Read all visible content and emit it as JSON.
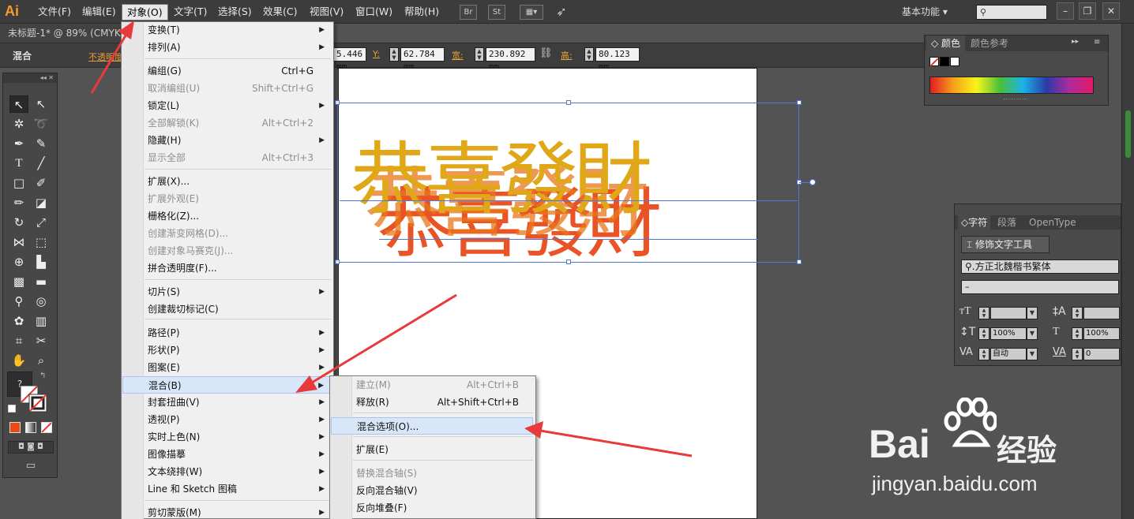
{
  "app": {
    "logo": "Ai"
  },
  "menubar": {
    "items": [
      "文件(F)",
      "编辑(E)",
      "对象(O)",
      "文字(T)",
      "选择(S)",
      "效果(C)",
      "视图(V)",
      "窗口(W)",
      "帮助(H)"
    ],
    "active": "对象(O)",
    "toolbar_icons": [
      "Br",
      "St"
    ],
    "workspace": "基本功能",
    "search_placeholder": "",
    "window_controls": [
      "–",
      "❐",
      "✕"
    ]
  },
  "document": {
    "tab": "未标题-1* @ 89% (CMYK"
  },
  "control_bar": {
    "blend_label": "混合",
    "opacity_label": "不透明度",
    "x_value": "5.446 mm",
    "y_label": "Y:",
    "y_value": "62.784 mm",
    "w_label": "宽:",
    "w_value": "230.892 mm",
    "h_label": "高:",
    "h_value": "80.123 mm"
  },
  "object_menu": {
    "items": [
      {
        "label": "变换(T)",
        "shortcut": "",
        "submenu": true,
        "disabled": false
      },
      {
        "label": "排列(A)",
        "shortcut": "",
        "submenu": true,
        "disabled": false
      },
      {
        "label": "编组(G)",
        "shortcut": "Ctrl+G",
        "submenu": false,
        "disabled": false
      },
      {
        "label": "取消编组(U)",
        "shortcut": "Shift+Ctrl+G",
        "submenu": false,
        "disabled": true
      },
      {
        "label": "锁定(L)",
        "shortcut": "",
        "submenu": true,
        "disabled": false
      },
      {
        "label": "全部解锁(K)",
        "shortcut": "Alt+Ctrl+2",
        "submenu": false,
        "disabled": true
      },
      {
        "label": "隐藏(H)",
        "shortcut": "",
        "submenu": true,
        "disabled": false
      },
      {
        "label": "显示全部",
        "shortcut": "Alt+Ctrl+3",
        "submenu": false,
        "disabled": true
      },
      {
        "label": "扩展(X)...",
        "shortcut": "",
        "submenu": false,
        "disabled": false
      },
      {
        "label": "扩展外观(E)",
        "shortcut": "",
        "submenu": false,
        "disabled": true
      },
      {
        "label": "栅格化(Z)...",
        "shortcut": "",
        "submenu": false,
        "disabled": false
      },
      {
        "label": "创建渐变网格(D)...",
        "shortcut": "",
        "submenu": false,
        "disabled": true
      },
      {
        "label": "创建对象马赛克(J)...",
        "shortcut": "",
        "submenu": false,
        "disabled": true
      },
      {
        "label": "拼合透明度(F)...",
        "shortcut": "",
        "submenu": false,
        "disabled": false
      },
      {
        "label": "切片(S)",
        "shortcut": "",
        "submenu": true,
        "disabled": false
      },
      {
        "label": "创建裁切标记(C)",
        "shortcut": "",
        "submenu": false,
        "disabled": false
      },
      {
        "label": "路径(P)",
        "shortcut": "",
        "submenu": true,
        "disabled": false
      },
      {
        "label": "形状(P)",
        "shortcut": "",
        "submenu": true,
        "disabled": false
      },
      {
        "label": "图案(E)",
        "shortcut": "",
        "submenu": true,
        "disabled": false
      },
      {
        "label": "混合(B)",
        "shortcut": "",
        "submenu": true,
        "disabled": false
      },
      {
        "label": "封套扭曲(V)",
        "shortcut": "",
        "submenu": true,
        "disabled": false
      },
      {
        "label": "透视(P)",
        "shortcut": "",
        "submenu": true,
        "disabled": false
      },
      {
        "label": "实时上色(N)",
        "shortcut": "",
        "submenu": true,
        "disabled": false
      },
      {
        "label": "图像描摹",
        "shortcut": "",
        "submenu": true,
        "disabled": false
      },
      {
        "label": "文本绕排(W)",
        "shortcut": "",
        "submenu": true,
        "disabled": false
      },
      {
        "label": "Line 和 Sketch 图稿",
        "shortcut": "",
        "submenu": true,
        "disabled": false
      },
      {
        "label": "剪切蒙版(M)",
        "shortcut": "",
        "submenu": true,
        "disabled": false
      }
    ]
  },
  "blend_submenu": {
    "items": [
      {
        "label": "建立(M)",
        "shortcut": "Alt+Ctrl+B",
        "disabled": true
      },
      {
        "label": "释放(R)",
        "shortcut": "Alt+Shift+Ctrl+B",
        "disabled": false
      },
      {
        "label": "混合选项(O)...",
        "shortcut": "",
        "disabled": false
      },
      {
        "label": "扩展(E)",
        "shortcut": "",
        "disabled": false
      },
      {
        "label": "替换混合轴(S)",
        "shortcut": "",
        "disabled": true
      },
      {
        "label": "反向混合轴(V)",
        "shortcut": "",
        "disabled": false
      },
      {
        "label": "反向堆叠(F)",
        "shortcut": "",
        "disabled": false
      }
    ]
  },
  "artwork": {
    "text": "恭喜發財",
    "top_color": "#e0a818",
    "bottom_color": "#e84a1a"
  },
  "color_panel": {
    "tabs": [
      "颜色",
      "颜色参考"
    ]
  },
  "char_panel": {
    "tabs": [
      "字符",
      "段落",
      "OpenType"
    ],
    "touch_type_button": "修饰文字工具",
    "font_family": "方正北魏楷书繁体",
    "font_style": "–",
    "font_size": "",
    "leading": "",
    "vertical_scale": "100%",
    "horizontal_scale": "100%",
    "kerning": "自动",
    "tracking": "0"
  },
  "watermark": {
    "brand": "Bai",
    "brand_cn": "经验",
    "url": "jingyan.baidu.com"
  },
  "colors": {
    "accent": "#e79b3a",
    "arrow": "#e83a3a",
    "selection": "#4e79d6"
  }
}
